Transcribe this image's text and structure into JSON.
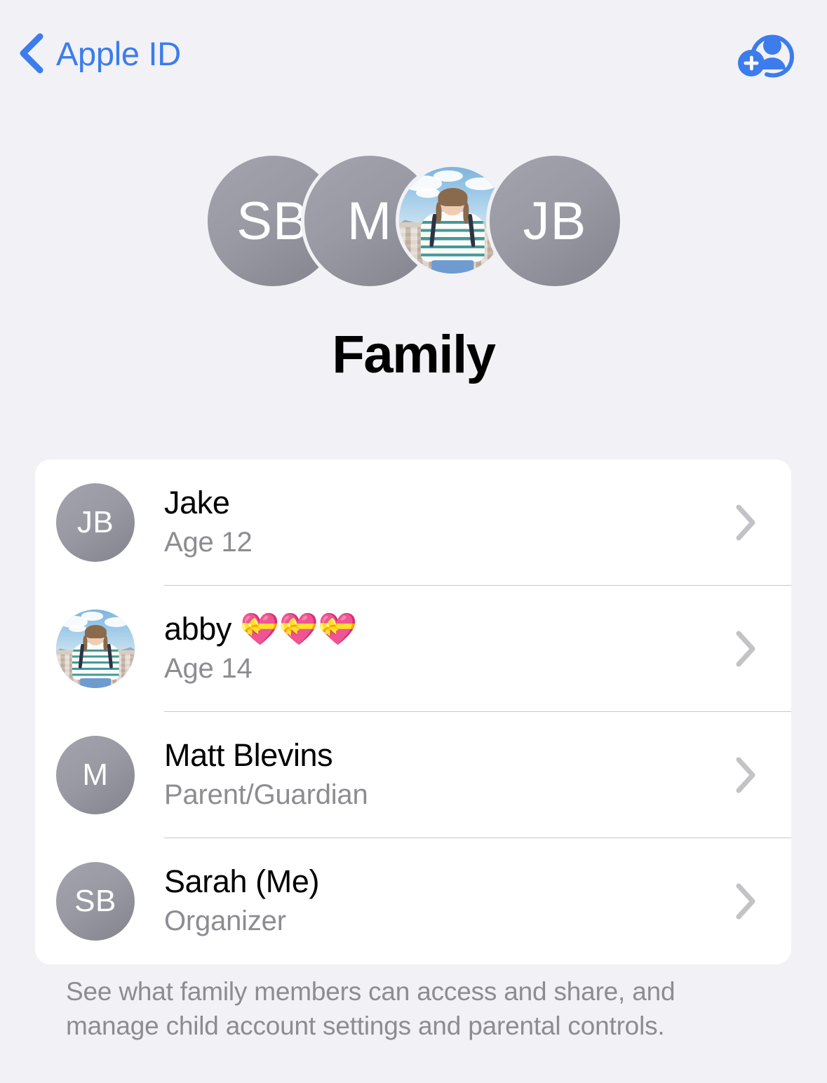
{
  "navbar": {
    "back_label": "Apple ID",
    "back_icon": "chevron-left-icon",
    "add_member_icon": "add-person-icon",
    "accent_color": "#3c7cec"
  },
  "hero": {
    "title": "Family",
    "avatars": [
      {
        "type": "initials",
        "initials": "SB",
        "name": "Sarah"
      },
      {
        "type": "initials",
        "initials": "M",
        "name": "Matt"
      },
      {
        "type": "photo",
        "initials": "",
        "name": "abby"
      },
      {
        "type": "initials",
        "initials": "JB",
        "name": "Jake"
      }
    ]
  },
  "members": [
    {
      "avatar_type": "initials",
      "avatar_initials": "JB",
      "name": "Jake",
      "detail": "Age 12",
      "chevron_icon": "chevron-right-icon"
    },
    {
      "avatar_type": "photo",
      "avatar_initials": "",
      "name": "abby 💝💝💝",
      "detail": "Age 14",
      "chevron_icon": "chevron-right-icon"
    },
    {
      "avatar_type": "initials",
      "avatar_initials": "M",
      "name": "Matt Blevins",
      "detail": "Parent/Guardian",
      "chevron_icon": "chevron-right-icon"
    },
    {
      "avatar_type": "initials",
      "avatar_initials": "SB",
      "name": "Sarah (Me)",
      "detail": "Organizer",
      "chevron_icon": "chevron-right-icon"
    }
  ],
  "footer": {
    "note": "See what family members can access and share, and manage child account settings and parental controls."
  },
  "colors": {
    "background": "#f2f1f6",
    "card": "#ffffff",
    "primary_text": "#000000",
    "secondary_text": "#8c8c91",
    "separator": "#c9c9ce",
    "chevron": "#c2c2c7",
    "avatar_gray": "#9a9aa4",
    "accent": "#3c7cec"
  }
}
